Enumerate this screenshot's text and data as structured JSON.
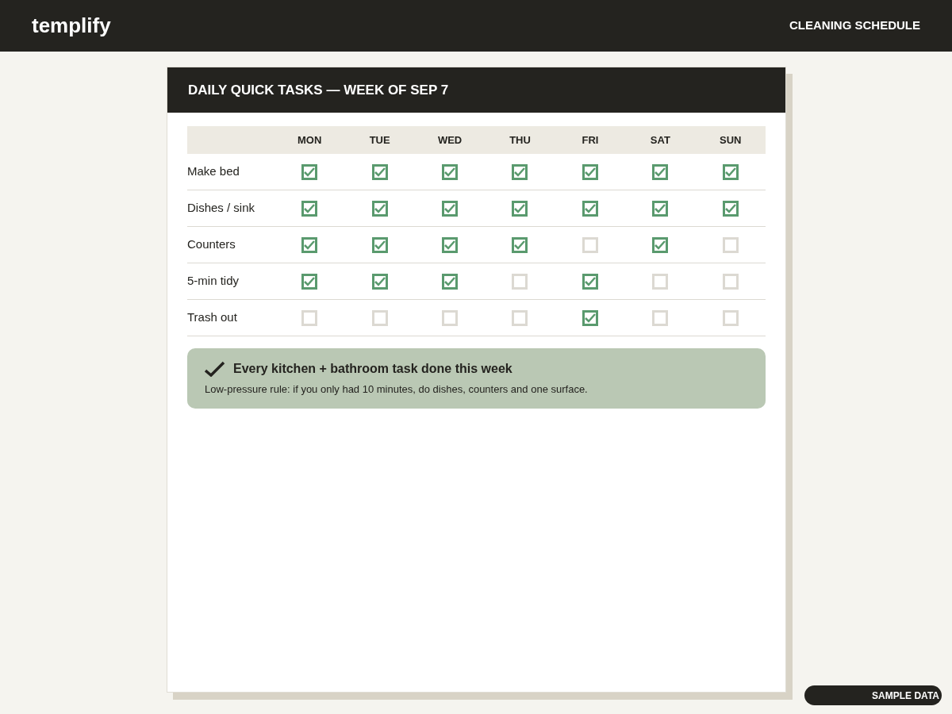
{
  "header": {
    "logo": "templify",
    "title": "CLEANING SCHEDULE"
  },
  "card": {
    "title": "DAILY QUICK TASKS — WEEK OF SEP 7",
    "days": [
      "MON",
      "TUE",
      "WED",
      "THU",
      "FRI",
      "SAT",
      "SUN"
    ],
    "tasks": [
      {
        "name": "Make bed",
        "checks": [
          true,
          true,
          true,
          true,
          true,
          true,
          true
        ]
      },
      {
        "name": "Dishes / sink",
        "checks": [
          true,
          true,
          true,
          true,
          true,
          true,
          true
        ]
      },
      {
        "name": "Counters",
        "checks": [
          true,
          true,
          true,
          true,
          false,
          true,
          false
        ]
      },
      {
        "name": "5-min tidy",
        "checks": [
          true,
          true,
          true,
          false,
          true,
          false,
          false
        ]
      },
      {
        "name": "Trash out",
        "checks": [
          false,
          false,
          false,
          false,
          true,
          false,
          false
        ]
      }
    ],
    "note": {
      "title": "Every kitchen + bathroom task done this week",
      "text": "Low-pressure rule: if you only had 10 minutes, do dishes, counters and one surface."
    }
  },
  "badge": "SAMPLE DATA"
}
